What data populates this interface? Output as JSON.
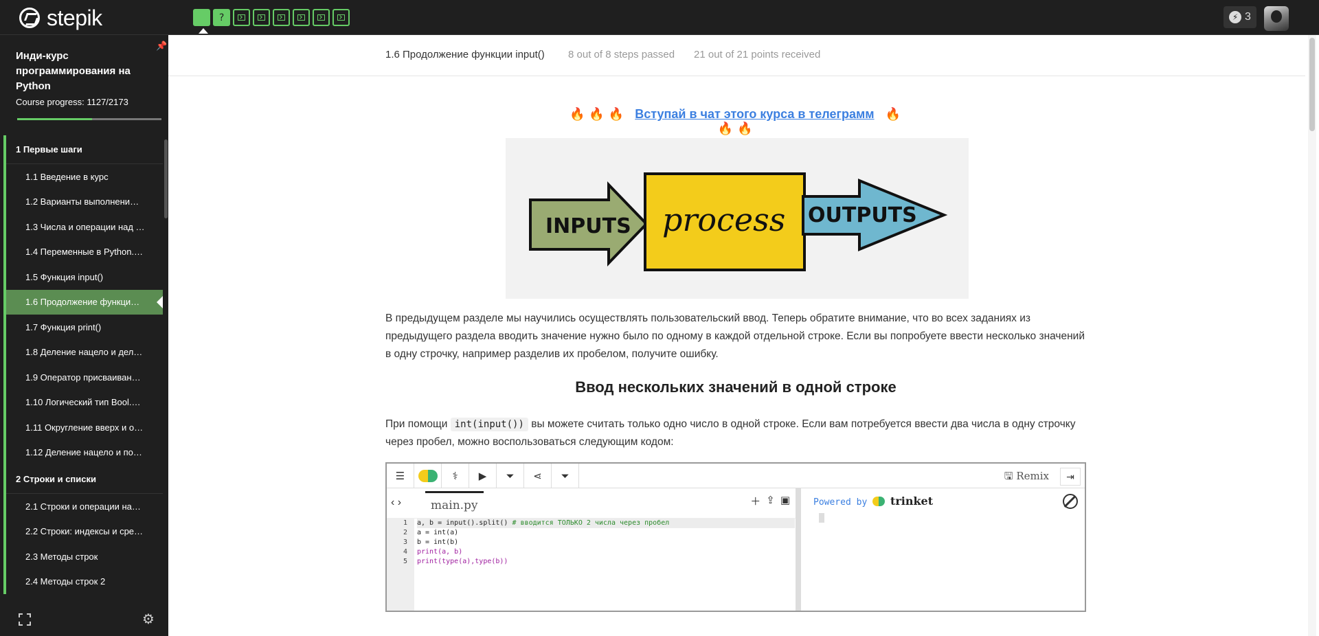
{
  "app": {
    "logo": "stepik"
  },
  "topbar": {
    "steps": [
      {
        "type": "text",
        "state": "passed",
        "current": true,
        "glyph": ""
      },
      {
        "type": "quiz",
        "state": "passed",
        "glyph": "?"
      },
      {
        "type": "code",
        "state": "passed",
        "glyph": ""
      },
      {
        "type": "code",
        "state": "passed",
        "glyph": ""
      },
      {
        "type": "code",
        "state": "passed",
        "glyph": ""
      },
      {
        "type": "code",
        "state": "passed",
        "glyph": ""
      },
      {
        "type": "code",
        "state": "passed",
        "glyph": ""
      },
      {
        "type": "code",
        "state": "passed",
        "glyph": ""
      }
    ],
    "energy": "3"
  },
  "sidebar": {
    "course_title": "Инди-курс программирования на Python",
    "progress_label": "Course progress:",
    "progress_value": "1127/2173",
    "progress_fraction": 0.5187,
    "sections": [
      {
        "title": "1  Первые шаги",
        "lessons": [
          "1.1  Введение в курс",
          "1.2  Варианты выполнени…",
          "1.3  Числа и операции над …",
          "1.4  Переменные в Python.…",
          "1.5  Функция input()",
          "1.6  Продолжение функци…",
          "1.7  Функция print()",
          "1.8  Деление нацело и дел…",
          "1.9  Оператор присваиван…",
          "1.10  Логический тип Bool.…",
          "1.11  Округление вверх и о…",
          "1.12  Деление нацело и по…"
        ]
      },
      {
        "title": "2  Строки и списки",
        "lessons": [
          "2.1  Строки и операции на…",
          "2.2  Строки: индексы и сре…",
          "2.3  Методы строк",
          "2.4  Методы строк 2"
        ]
      }
    ],
    "active_lesson": "1.6  Продолжение функци…"
  },
  "lesson": {
    "title": "1.6 Продолжение функции input()",
    "steps_passed": "8 out of 8 steps passed",
    "points": "21 out of 21 points  received",
    "telegram_link": "Вступай в чат этого курса в телеграмм",
    "image": {
      "inputs": "INPUTS",
      "process": "process",
      "outputs": "OUTPUTS"
    },
    "paragraph1": "В предыдущем разделе мы научились осуществлять пользовательский ввод. Теперь обратите внимание, что во всех заданиях из предыдущего раздела вводить значение нужно было по одному в каждой отдельной строке. Если вы попробуете ввести несколько значений в одну строчку, например разделив их пробелом, получите ошибку.",
    "heading": "Ввод нескольких значений в одной строке",
    "paragraph2_before": "При помощи",
    "paragraph2_code": "int(input())",
    "paragraph2_after": "вы можете считать только одно число в одной строке. Если вам потребуется ввести два числа в одну строчку через пробел, можно воспользоваться следующим кодом:"
  },
  "trinket": {
    "remix_label": "Remix",
    "filename": "main.py",
    "powered_by": "Powered by",
    "brand": "trinket",
    "line_numbers": [
      "1",
      "2",
      "3",
      "4",
      "5"
    ],
    "code_lines": [
      {
        "code": "a, b = input().split() ",
        "comment": "# вводится ТОЛЬКО 2 числа через пробел"
      },
      {
        "code": "a = int(a)",
        "comment": ""
      },
      {
        "code": "b = int(b)",
        "comment": ""
      },
      {
        "code": "print(a, b)",
        "comment": ""
      },
      {
        "code": "print(type(a),type(b))",
        "comment": ""
      }
    ]
  },
  "colors": {
    "accent_green": "#66cc66",
    "active_lesson": "#5b8d52",
    "link_blue": "#3b7fe0",
    "fire": "#f07a1a"
  }
}
